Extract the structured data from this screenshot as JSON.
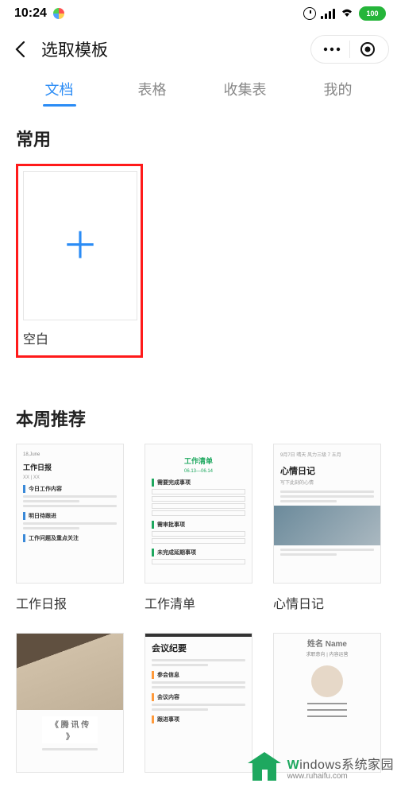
{
  "status": {
    "time": "10:24",
    "battery": "100"
  },
  "header": {
    "title": "选取模板"
  },
  "tabs": {
    "items": [
      {
        "label": "文档",
        "active": true
      },
      {
        "label": "表格",
        "active": false
      },
      {
        "label": "收集表",
        "active": false
      },
      {
        "label": "我的",
        "active": false
      }
    ]
  },
  "sections": {
    "frequent": {
      "title": "常用",
      "blank": {
        "label": "空白"
      }
    },
    "weekly": {
      "title": "本周推荐",
      "items": [
        {
          "label": "工作日报"
        },
        {
          "label": "工作清单"
        },
        {
          "label": "心情日记"
        }
      ]
    }
  },
  "mini": {
    "daily_date": "18,June",
    "daily_title": "工作日报",
    "daily_sub": "XX | XX",
    "daily_h1": "今日工作内容",
    "daily_h2": "明日待跟进",
    "daily_h3": "工作问题及重点关注",
    "checklist_title": "工作清单",
    "checklist_sub": "06.13—06.14",
    "checklist_h1": "需要完成事项",
    "checklist_h2": "需审批事项",
    "checklist_h3": "未完成延期事项",
    "diary_top": "9月7日 晴天 风力三级 7 五月",
    "diary_title": "心情日记",
    "diary_sub": "写下此刻的心情",
    "meeting_title": "会议纪要",
    "book_title": "《 腾 讯 传 》",
    "resume_name": "姓名 Name",
    "resume_sub": "求职意向 | 内容运营"
  },
  "watermark": {
    "line1_prefix": "W",
    "line1_rest": "indows系统家园",
    "line2": "www.ruhaifu.com"
  }
}
